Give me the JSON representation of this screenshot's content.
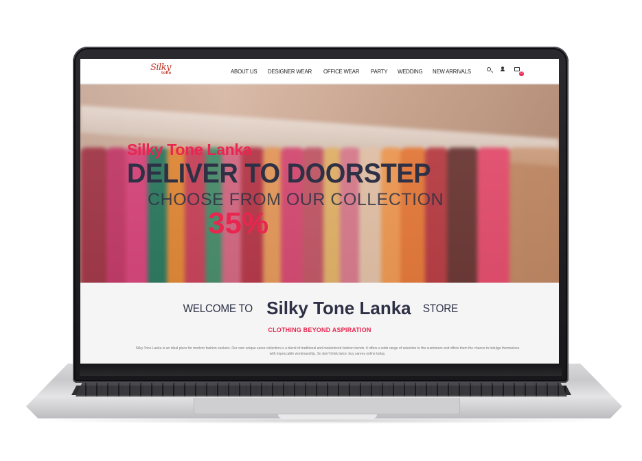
{
  "nav": {
    "logo_script": "Silky",
    "logo_sub": "tone",
    "menu": [
      "ABOUT US",
      "DESIGNER WEAR",
      "OFFICE WEAR",
      "PARTY",
      "WEDDING",
      "NEW ARRIVALS"
    ],
    "icons": [
      "search-icon",
      "user-icon",
      "cart-icon"
    ],
    "cart_count": "0"
  },
  "hero": {
    "subtitle": "Silky Tone Lanka",
    "title": "DELIVER TO DOORSTEP",
    "line": "CHOOSE FROM OUR COLLECTION",
    "percent": "35%"
  },
  "welcome": {
    "prefix": "WELCOME TO",
    "name": "Silky Tone Lanka",
    "suffix": "STORE",
    "tagline": "CLOTHING BEYOND ASPIRATION",
    "description": "Silky Tone Lanka is an ideal place for modern fashion seekers. Our own unique saree collection is a blend of traditional and modernized fashion trends. It offers a wide range of selection to the customers and offers them the chance to indulge themselves with impeccable workmanship. So don't think twice; buy sarees online today."
  },
  "colors": {
    "accent": "#e8264f",
    "dark": "#2e3145"
  }
}
